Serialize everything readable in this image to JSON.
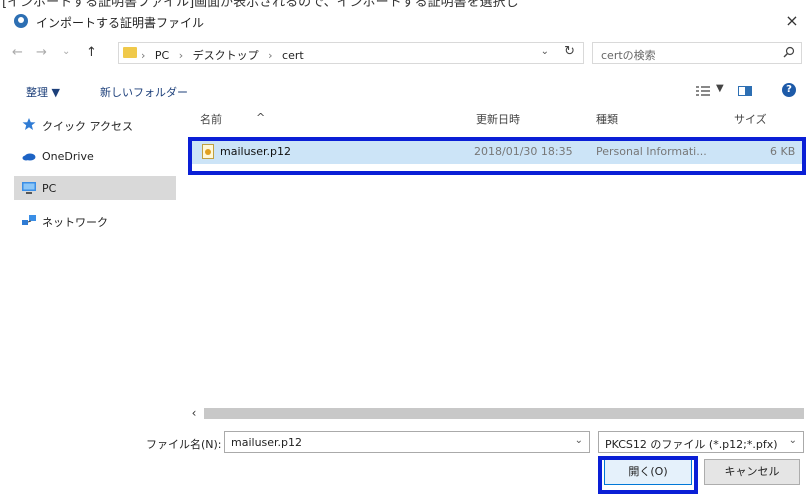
{
  "caption": "[インポートする証明書ファイル]画面が表示されるので、インポートする証明書を選択し",
  "window": {
    "title": "インポートする証明書ファイル",
    "close_glyph": "×"
  },
  "nav": {
    "back_glyph": "←",
    "forward_glyph": "→",
    "recent_glyph": "⌄",
    "up_glyph": "↑",
    "breadcrumbs": [
      "PC",
      "デスクトップ",
      "cert"
    ],
    "separator": "›",
    "search_placeholder": "certの検索"
  },
  "toolbar": {
    "organize_label": "整理 ▼",
    "new_folder_label": "新しいフォルダー",
    "view_dd": "▼",
    "help_glyph": "?"
  },
  "sidebar": {
    "items": [
      {
        "label": "クイック アクセス",
        "icon": "star-icon"
      },
      {
        "label": "OneDrive",
        "icon": "cloud-icon"
      },
      {
        "label": "PC",
        "icon": "computer-icon"
      },
      {
        "label": "ネットワーク",
        "icon": "network-icon"
      }
    ]
  },
  "columns": {
    "name": "名前",
    "date": "更新日時",
    "type": "種類",
    "size": "サイズ"
  },
  "files": [
    {
      "name": "mailuser.p12",
      "date": "2018/01/30 18:35",
      "type": "Personal Informati...",
      "size": "6 KB"
    }
  ],
  "scroll_left_glyph": "‹",
  "bottom": {
    "filename_label": "ファイル名(N):",
    "filename_value": "mailuser.p12",
    "filter_value": "PKCS12 のファイル (*.p12;*.pfx)",
    "dd_glyph": "⌄",
    "open_label": "開く(O)",
    "cancel_label": "キャンセル"
  },
  "colors": {
    "highlight_border": "#0a1fd6",
    "selected_row": "#cce4f7",
    "sidebar_selected": "#d9d9d9"
  }
}
